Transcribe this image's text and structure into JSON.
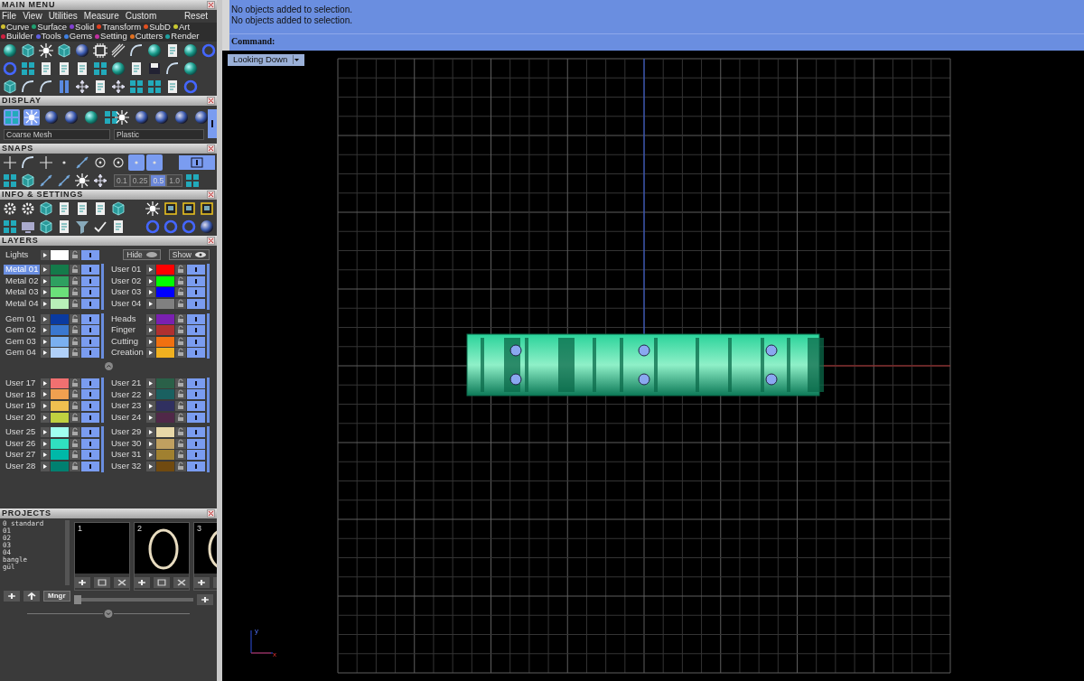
{
  "main_menu": {
    "title": "MAIN MENU",
    "menu": [
      "File",
      "View",
      "Utilities",
      "Measure",
      "Custom"
    ],
    "reset": "Reset",
    "categories": [
      {
        "label": "Curve",
        "color": "#d0c030"
      },
      {
        "label": "Surface",
        "color": "#20a070"
      },
      {
        "label": "Solid",
        "color": "#8040d0"
      },
      {
        "label": "Transform",
        "color": "#e04020"
      },
      {
        "label": "SubD",
        "color": "#e05020"
      },
      {
        "label": "Art",
        "color": "#c8c830"
      },
      {
        "label": "Builder",
        "color": "#d02040"
      },
      {
        "label": "Tools",
        "color": "#6060e0"
      },
      {
        "label": "Gems",
        "color": "#4080e0"
      },
      {
        "label": "Setting",
        "color": "#c030a0"
      },
      {
        "label": "Cutters",
        "color": "#e07020"
      },
      {
        "label": "Render",
        "color": "#20a0a0"
      }
    ]
  },
  "display": {
    "title": "DISPLAY",
    "tools": [
      {
        "on": true
      },
      {
        "on": true
      },
      {
        "on": false
      },
      {
        "on": false
      },
      {
        "on": false
      },
      {
        "on": false
      }
    ],
    "mesh": "Coarse Mesh",
    "material": "Plastic"
  },
  "snaps": {
    "title": "SNAPS",
    "tools": [
      {
        "on": false
      },
      {
        "on": false
      },
      {
        "on": false
      },
      {
        "on": false
      },
      {
        "on": false
      },
      {
        "on": false
      },
      {
        "on": false
      },
      {
        "on": true
      },
      {
        "on": true
      }
    ],
    "steps": [
      {
        "label": "0.1",
        "selected": false
      },
      {
        "label": "0.25",
        "selected": false
      },
      {
        "label": "0.5",
        "selected": true
      },
      {
        "label": "1.0",
        "selected": false
      }
    ]
  },
  "info": {
    "title": "INFO & SETTINGS"
  },
  "layers": {
    "title": "LAYERS",
    "lights": {
      "label": "Lights",
      "color": "#ffffff"
    },
    "hide": "Hide",
    "show": "Show",
    "banks": [
      {
        "groups": [
          {
            "left": [
              {
                "name": "Metal 01",
                "color": "#147a4a",
                "selected": true
              },
              {
                "name": "Metal 02",
                "color": "#2ea060",
                "selected": false
              },
              {
                "name": "Metal 03",
                "color": "#6be07a",
                "selected": false
              },
              {
                "name": "Metal 04",
                "color": "#b8f0b8",
                "selected": false
              }
            ],
            "right": [
              {
                "name": "User 01",
                "color": "#ff0000",
                "selected": false
              },
              {
                "name": "User 02",
                "color": "#00ff00",
                "selected": false
              },
              {
                "name": "User 03",
                "color": "#0000ff",
                "selected": false
              },
              {
                "name": "User 04",
                "color": "#808080",
                "selected": false
              }
            ]
          },
          {
            "left": [
              {
                "name": "Gem 01",
                "color": "#0a3aa0",
                "selected": false
              },
              {
                "name": "Gem 02",
                "color": "#3a78d0",
                "selected": false
              },
              {
                "name": "Gem 03",
                "color": "#7ab0f0",
                "selected": false
              },
              {
                "name": "Gem 04",
                "color": "#b0d0f8",
                "selected": false
              }
            ],
            "right": [
              {
                "name": "Heads",
                "color": "#7a20b0",
                "selected": false
              },
              {
                "name": "Finger",
                "color": "#b03030",
                "selected": false
              },
              {
                "name": "Cutting",
                "color": "#f07010",
                "selected": false
              },
              {
                "name": "Creation",
                "color": "#f0b020",
                "selected": false
              }
            ]
          }
        ]
      },
      {
        "groups": [
          {
            "left": [
              {
                "name": "User 17",
                "color": "#f07070",
                "selected": false
              },
              {
                "name": "User 18",
                "color": "#f0a050",
                "selected": false
              },
              {
                "name": "User 19",
                "color": "#f0c050",
                "selected": false
              },
              {
                "name": "User 20",
                "color": "#c0d040",
                "selected": false
              }
            ],
            "right": [
              {
                "name": "User 21",
                "color": "#2a6048",
                "selected": false
              },
              {
                "name": "User 22",
                "color": "#1a6060",
                "selected": false
              },
              {
                "name": "User 23",
                "color": "#303060",
                "selected": false
              },
              {
                "name": "User 24",
                "color": "#502848",
                "selected": false
              }
            ]
          },
          {
            "left": [
              {
                "name": "User 25",
                "color": "#a0fff0",
                "selected": false
              },
              {
                "name": "User 26",
                "color": "#30e0c0",
                "selected": false
              },
              {
                "name": "User 27",
                "color": "#00b8a8",
                "selected": false
              },
              {
                "name": "User 28",
                "color": "#008070",
                "selected": false
              }
            ],
            "right": [
              {
                "name": "User 29",
                "color": "#e8d8a8",
                "selected": false
              },
              {
                "name": "User 30",
                "color": "#c0a060",
                "selected": false
              },
              {
                "name": "User 31",
                "color": "#a08030",
                "selected": false
              },
              {
                "name": "User 32",
                "color": "#704a10",
                "selected": false
              }
            ]
          }
        ]
      }
    ]
  },
  "projects": {
    "title": "PROJECTS",
    "items": [
      "0 standard",
      "01",
      "02",
      "03",
      "04",
      "bangle",
      "gül"
    ],
    "manager": "Mngr",
    "slots": [
      {
        "number": "1",
        "kind": "empty"
      },
      {
        "number": "2",
        "kind": "ring"
      },
      {
        "number": "3",
        "kind": "ring"
      }
    ],
    "level": 0
  },
  "console": {
    "lines": [
      "No objects added to selection.",
      "No objects added to selection."
    ],
    "prompt": "Command:"
  },
  "viewport": {
    "view": "Looking Down",
    "axes": {
      "x": "x",
      "y": "y"
    }
  }
}
